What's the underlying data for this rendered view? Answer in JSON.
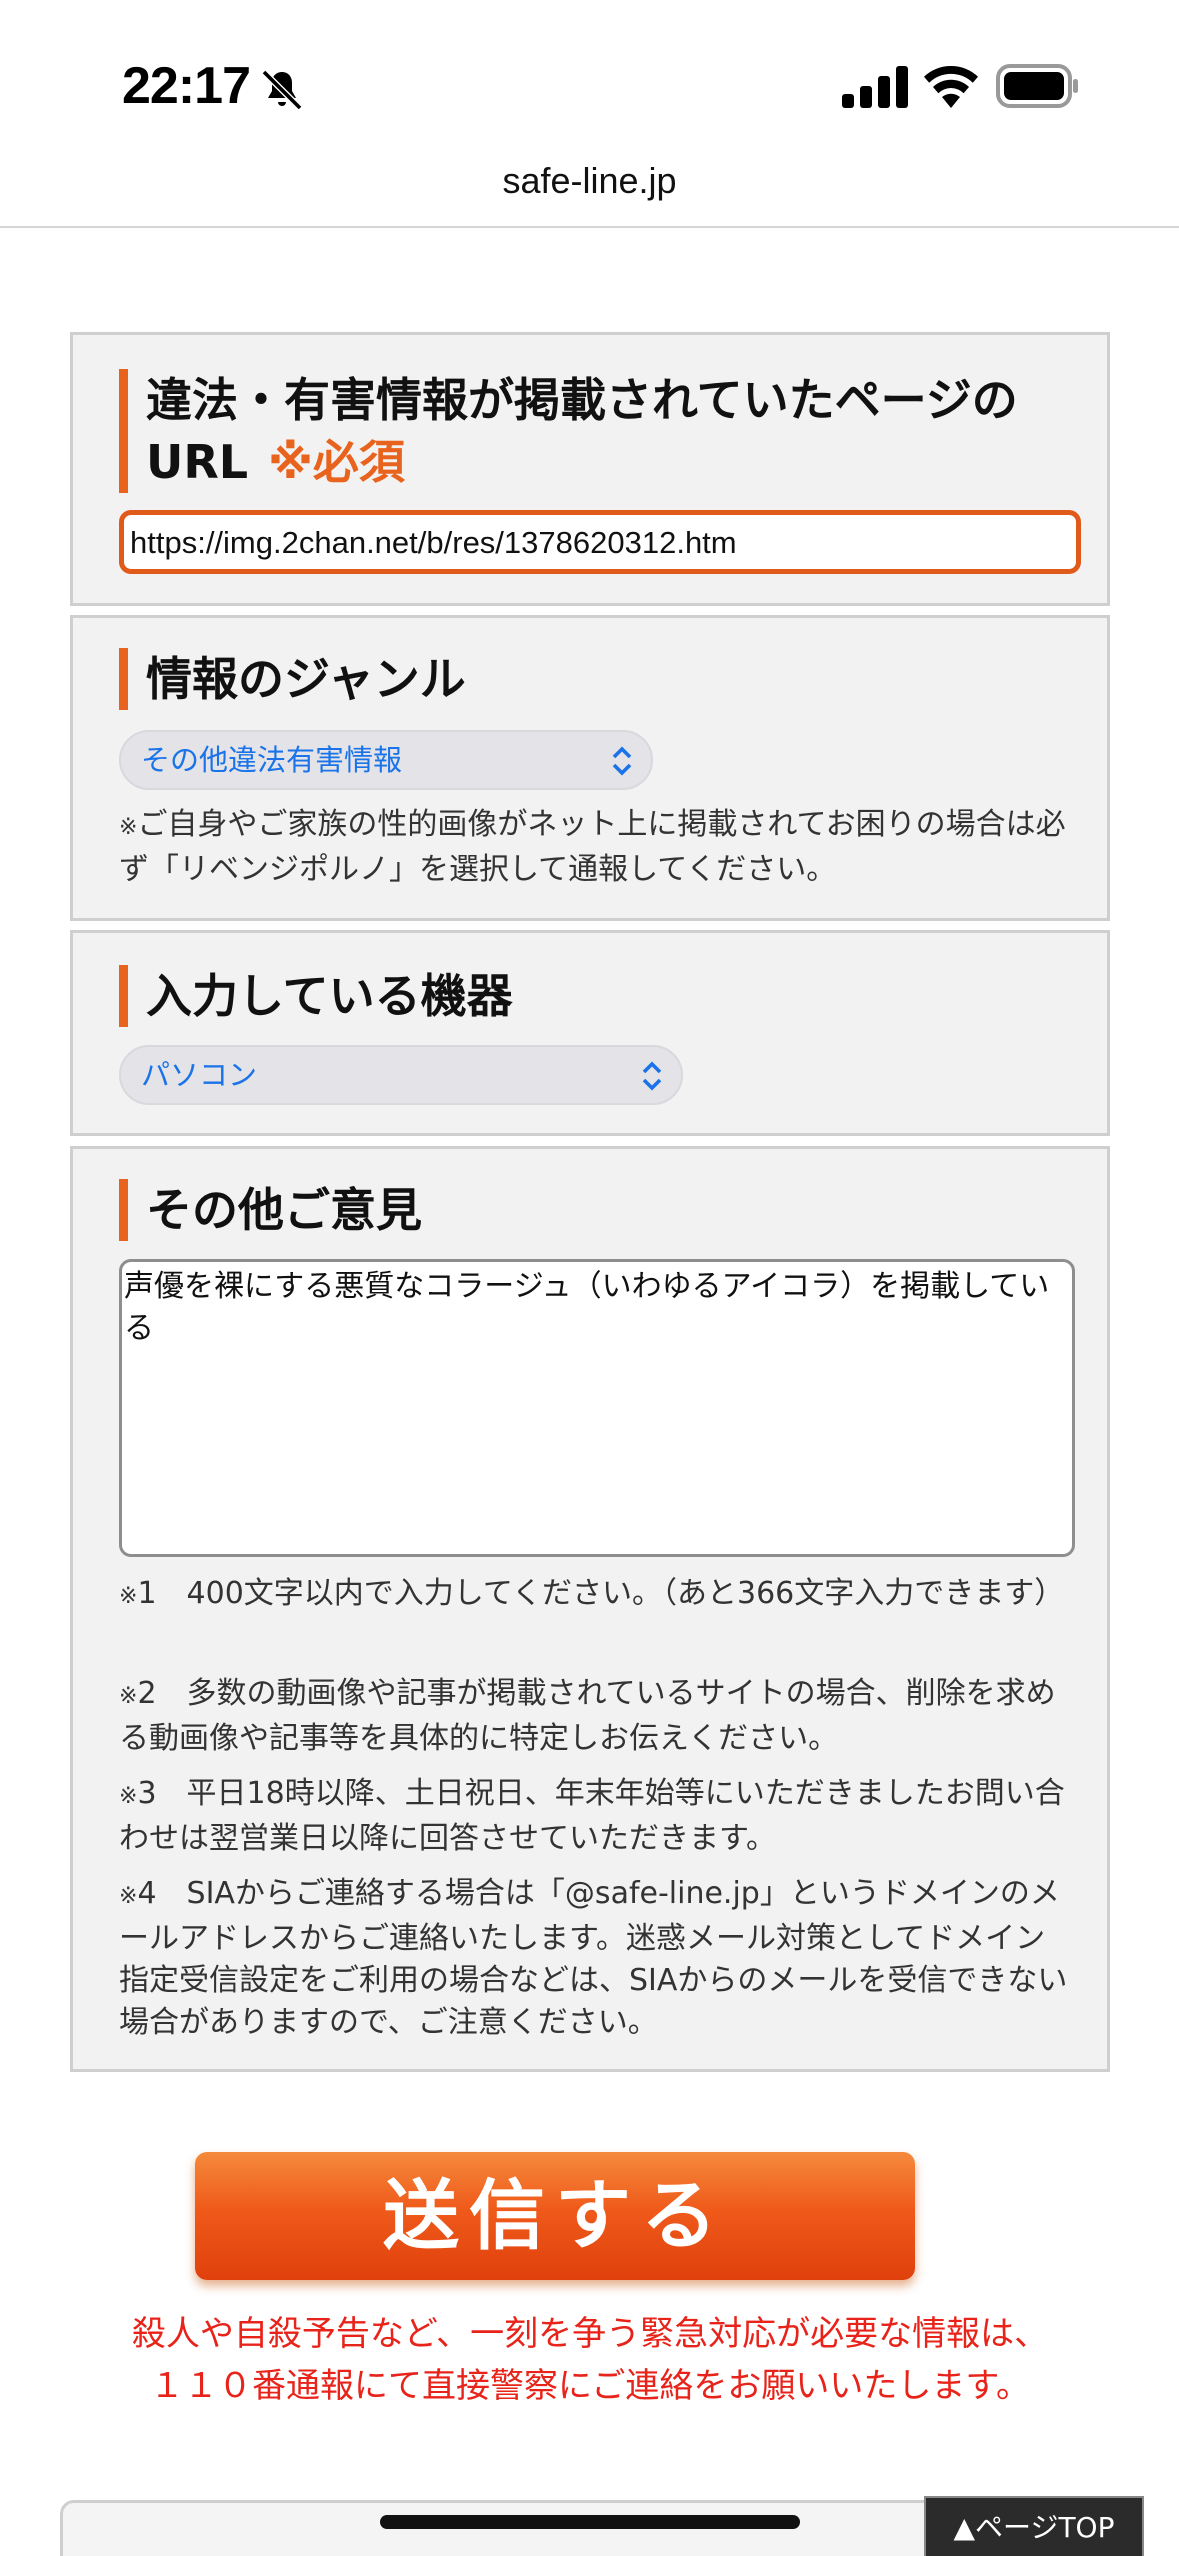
{
  "status_bar": {
    "time": "22:17"
  },
  "browser": {
    "url": "safe-line.jp"
  },
  "form": {
    "url_section": {
      "heading_line1": "違法・有害情報が掲載されていたページの",
      "heading_line2": "URL",
      "required": "※必須",
      "value": "https://img.2chan.net/b/res/1378620312.htm"
    },
    "genre_section": {
      "heading": "情報のジャンル",
      "selected": "その他違法有害情報",
      "note_mark": "※",
      "note": "ご自身やご家族の性的画像がネット上に掲載されてお困りの場合は必ず「リベンジポルノ」を選択して通報してください。"
    },
    "device_section": {
      "heading": "入力している機器",
      "selected": "パソコン"
    },
    "opinion_section": {
      "heading": "その他ご意見",
      "value": "声優を裸にする悪質なコラージュ（いわゆるアイコラ）を掲載している",
      "notes": [
        {
          "mark": "※",
          "text": "1　400文字以内で入力してください。（あと366文字入力できます）"
        },
        {
          "mark": "※",
          "text": "2　多数の動画像や記事が掲載されているサイトの場合、削除を求める動画像や記事等を具体的に特定しお伝えください。"
        },
        {
          "mark": "※",
          "text": "3　平日18時以降、土日祝日、年末年始等にいただきましたお問い合わせは翌営業日以降に回答させていただきます。"
        },
        {
          "mark": "※",
          "text": "4　SIAからご連絡する場合は「@safe-line.jp」というドメインのメールアドレスからご連絡いたします。迷惑メール対策としてドメイン指定受信設定をご利用の場合などは、SIAからのメールを受信できない場合がありますので、ご注意ください。"
        }
      ]
    }
  },
  "submit_label": "送信する",
  "warning_line1": "殺人や自殺予告など、一刻を争う緊急対応が必要な情報は、",
  "warning_line2": "１１０番通報にて直接警察にご連絡をお願いいたします。",
  "page_top_label": "▲ページTOP",
  "colors": {
    "accent": "#e8641e",
    "warning": "#e8231a",
    "select_text": "#1a73e8"
  }
}
